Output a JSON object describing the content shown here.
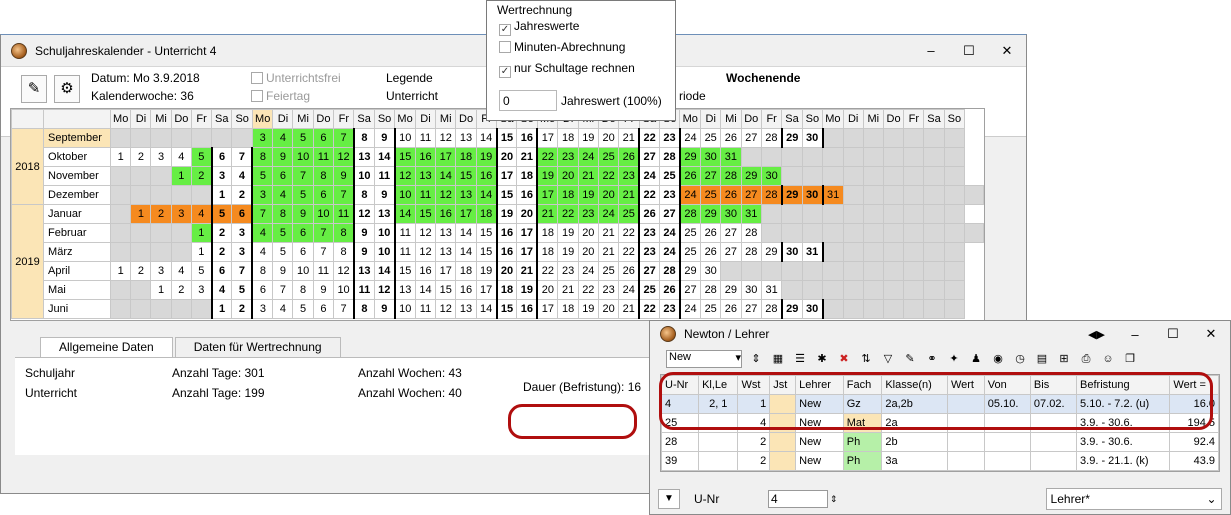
{
  "window": {
    "title": "Schuljahreskalender - Unterricht 4",
    "min": "–",
    "max": "☐",
    "close": "✕"
  },
  "info": {
    "datum": "Datum: Mo 3.9.2018",
    "kw": "Kalenderwoche: 36",
    "unterrichtsfrei": "Unterrichtsfrei",
    "feiertag": "Feiertag",
    "legende": "Legende",
    "unterricht": "Unterricht",
    "wochenende": "Wochenende",
    "periode": "riode"
  },
  "popup": {
    "title": "Wertrechnung",
    "jahreswerte": "Jahreswerte",
    "minuten": "Minuten-Abrechnung",
    "schultage": "nur Schultage rechnen",
    "value": "0",
    "jahreswert_label": "Jahreswert (100%)",
    "check": "✓"
  },
  "calendar": {
    "weekdays": [
      "Mo",
      "Di",
      "Mi",
      "Do",
      "Fr",
      "Sa",
      "So",
      "Mo",
      "Di",
      "Mi",
      "Do",
      "Fr",
      "Sa",
      "So",
      "Mo",
      "Di",
      "Mi",
      "Do",
      "Fr",
      "Sa",
      "So",
      "Mo",
      "Di",
      "Mi",
      "Do",
      "Fr",
      "Sa",
      "So",
      "Mo",
      "Di",
      "Mi",
      "Do",
      "Fr",
      "Sa",
      "So",
      "Mo",
      "Di",
      "Mi",
      "Do",
      "Fr",
      "Sa",
      "So"
    ],
    "years": [
      "2018",
      "2019"
    ],
    "months": [
      {
        "name": "September",
        "days": [
          "",
          "",
          "",
          "",
          "",
          "",
          "",
          "3",
          "4",
          "5",
          "6",
          "7",
          "8",
          "9",
          "10",
          "11",
          "12",
          "13",
          "14",
          "15",
          "16",
          "17",
          "18",
          "19",
          "20",
          "21",
          "22",
          "23",
          "24",
          "25",
          "26",
          "27",
          "28",
          "29",
          "30",
          "",
          "",
          "",
          "",
          "",
          "",
          ""
        ]
      },
      {
        "name": "Oktober",
        "days": [
          "1",
          "2",
          "3",
          "4",
          "5",
          "6",
          "7",
          "8",
          "9",
          "10",
          "11",
          "12",
          "13",
          "14",
          "15",
          "16",
          "17",
          "18",
          "19",
          "20",
          "21",
          "22",
          "23",
          "24",
          "25",
          "26",
          "27",
          "28",
          "29",
          "30",
          "31",
          "",
          "",
          "",
          "",
          "",
          "",
          "",
          "",
          "",
          "",
          ""
        ]
      },
      {
        "name": "November",
        "days": [
          "",
          "",
          "",
          "1",
          "2",
          "3",
          "4",
          "5",
          "6",
          "7",
          "8",
          "9",
          "10",
          "11",
          "12",
          "13",
          "14",
          "15",
          "16",
          "17",
          "18",
          "19",
          "20",
          "21",
          "22",
          "23",
          "24",
          "25",
          "26",
          "27",
          "28",
          "29",
          "30",
          "",
          "",
          "",
          "",
          "",
          "",
          "",
          "",
          ""
        ]
      },
      {
        "name": "Dezember",
        "days": [
          "",
          "",
          "",
          "",
          "",
          "1",
          "2",
          "3",
          "4",
          "5",
          "6",
          "7",
          "8",
          "9",
          "10",
          "11",
          "12",
          "13",
          "14",
          "15",
          "16",
          "17",
          "18",
          "19",
          "20",
          "21",
          "22",
          "23",
          "24",
          "25",
          "26",
          "27",
          "28",
          "29",
          "30",
          "31",
          "",
          "",
          "",
          "",
          "",
          "",
          ""
        ]
      },
      {
        "name": "Januar",
        "days": [
          "",
          "1",
          "2",
          "3",
          "4",
          "5",
          "6",
          "7",
          "8",
          "9",
          "10",
          "11",
          "12",
          "13",
          "14",
          "15",
          "16",
          "17",
          "18",
          "19",
          "20",
          "21",
          "22",
          "23",
          "24",
          "25",
          "26",
          "27",
          "28",
          "29",
          "30",
          "31",
          "",
          "",
          "",
          "",
          "",
          "",
          "",
          "",
          "",
          ""
        ]
      },
      {
        "name": "Februar",
        "days": [
          "",
          "",
          "",
          "",
          "1",
          "2",
          "3",
          "4",
          "5",
          "6",
          "7",
          "8",
          "9",
          "10",
          "11",
          "12",
          "13",
          "14",
          "15",
          "16",
          "17",
          "18",
          "19",
          "20",
          "21",
          "22",
          "23",
          "24",
          "25",
          "26",
          "27",
          "28",
          "",
          "",
          "",
          "",
          "",
          "",
          "",
          "",
          "",
          "",
          ""
        ]
      },
      {
        "name": "März",
        "days": [
          "",
          "",
          "",
          "",
          "1",
          "2",
          "3",
          "4",
          "5",
          "6",
          "7",
          "8",
          "9",
          "10",
          "11",
          "12",
          "13",
          "14",
          "15",
          "16",
          "17",
          "18",
          "19",
          "20",
          "21",
          "22",
          "23",
          "24",
          "25",
          "26",
          "27",
          "28",
          "29",
          "30",
          "31",
          "",
          "",
          "",
          "",
          "",
          "",
          ""
        ]
      },
      {
        "name": "April",
        "days": [
          "1",
          "2",
          "3",
          "4",
          "5",
          "6",
          "7",
          "8",
          "9",
          "10",
          "11",
          "12",
          "13",
          "14",
          "15",
          "16",
          "17",
          "18",
          "19",
          "20",
          "21",
          "22",
          "23",
          "24",
          "25",
          "26",
          "27",
          "28",
          "29",
          "30",
          "",
          "",
          "",
          "",
          "",
          "",
          "",
          "",
          "",
          "",
          "",
          ""
        ]
      },
      {
        "name": "Mai",
        "days": [
          "",
          "",
          "1",
          "2",
          "3",
          "4",
          "5",
          "6",
          "7",
          "8",
          "9",
          "10",
          "11",
          "12",
          "13",
          "14",
          "15",
          "16",
          "17",
          "18",
          "19",
          "20",
          "21",
          "22",
          "23",
          "24",
          "25",
          "26",
          "27",
          "28",
          "29",
          "30",
          "31",
          "",
          "",
          "",
          "",
          "",
          "",
          "",
          "",
          ""
        ]
      },
      {
        "name": "Juni",
        "days": [
          "",
          "",
          "",
          "",
          "",
          "1",
          "2",
          "3",
          "4",
          "5",
          "6",
          "7",
          "8",
          "9",
          "10",
          "11",
          "12",
          "13",
          "14",
          "15",
          "16",
          "17",
          "18",
          "19",
          "20",
          "21",
          "22",
          "23",
          "24",
          "25",
          "26",
          "27",
          "28",
          "29",
          "30",
          "",
          "",
          "",
          "",
          "",
          "",
          ""
        ]
      }
    ],
    "colors": {
      "green": "#66ee44",
      "orange": "#f58a1f",
      "highlight": "#fbe5b6"
    }
  },
  "tabs": [
    "Allgemeine Daten",
    "Daten für Wertrechnung"
  ],
  "stats": {
    "schuljahr": "Schuljahr",
    "unterricht": "Unterricht",
    "tage1": "Anzahl Tage: 301",
    "tage2": "Anzahl Tage: 199",
    "wochen1": "Anzahl Wochen: 43",
    "wochen2": "Anzahl Wochen: 40",
    "dauer": "Dauer (Befristung): 16"
  },
  "newton": {
    "title": "Newton / Lehrer",
    "select": "New",
    "headers": [
      "U-Nr",
      "Kl,Le",
      "Wst",
      "Jst",
      "Lehrer",
      "Fach",
      "Klasse(n)",
      "Wert",
      "Von",
      "Bis",
      "Befristung",
      "Wert ="
    ],
    "rows": [
      [
        "4",
        "2, 1",
        "1",
        "",
        "New",
        "Gz",
        "2a,2b",
        "",
        "05.10.",
        "07.02.",
        "5.10. - 7.2. (u)",
        "16.0"
      ],
      [
        "25",
        "",
        "4",
        "",
        "New",
        "Mat",
        "2a",
        "",
        "",
        "",
        "3.9. - 30.6.",
        "194.5"
      ],
      [
        "28",
        "",
        "2",
        "",
        "New",
        "Ph",
        "2b",
        "",
        "",
        "",
        "3.9. - 30.6.",
        "92.4"
      ],
      [
        "39",
        "",
        "2",
        "",
        "New",
        "Ph",
        "3a",
        "",
        "",
        "",
        "3.9. - 21.1. (k)",
        "43.9"
      ]
    ],
    "unr_label": "U-Nr",
    "unr_value": "4",
    "lehrer_select": "Lehrer*"
  }
}
